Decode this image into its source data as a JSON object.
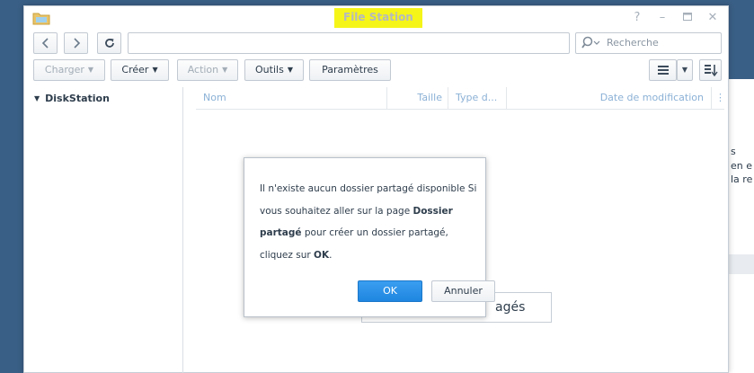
{
  "window": {
    "title": "File Station",
    "controls": [
      "help-icon",
      "minimize-icon",
      "maximize-icon",
      "close-icon"
    ]
  },
  "nav": {
    "back_icon": "chevron-left-icon",
    "forward_icon": "chevron-right-icon",
    "refresh_icon": "refresh-icon",
    "path_value": "",
    "search_placeholder": "Recherche"
  },
  "toolbar": {
    "upload_label": "Charger",
    "create_label": "Créer",
    "action_label": "Action",
    "tools_label": "Outils",
    "settings_label": "Paramètres"
  },
  "sidebar": {
    "root_label": "DiskStation"
  },
  "filelist": {
    "columns": [
      "Nom",
      "Taille",
      "Type d...",
      "Date de modification"
    ]
  },
  "background": {
    "toast_text": "agés",
    "panel_lines": [
      "s",
      "en e",
      "la re"
    ]
  },
  "dialog": {
    "msg_part1": "Il n'existe aucun dossier partagé disponible Si vous souhaitez aller sur la page ",
    "msg_bold1": "Dossier partagé",
    "msg_part2": " pour créer un dossier partagé, cliquez sur ",
    "msg_bold2": "OK",
    "msg_part3": ".",
    "ok_label": "OK",
    "cancel_label": "Annuler"
  },
  "colors": {
    "title_highlight": "#f5f51a",
    "primary_button": "#2a8fe6",
    "header_text": "#8bb1d6"
  }
}
